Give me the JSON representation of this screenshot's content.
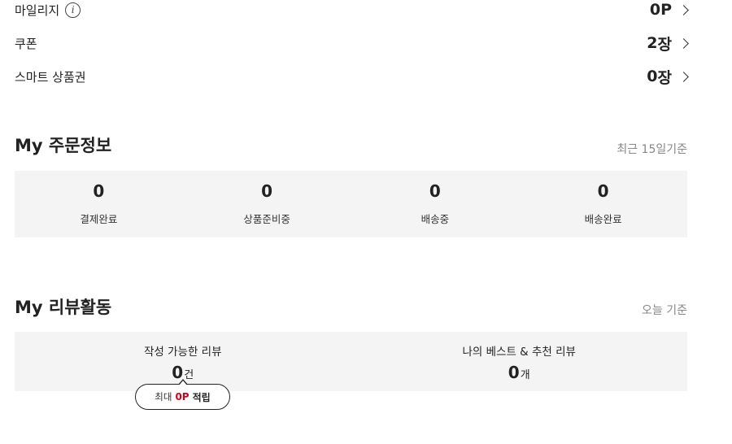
{
  "benefits": [
    {
      "label": "마일리지",
      "value": "0",
      "unit": "P",
      "has_info": true
    },
    {
      "label": "쿠폰",
      "value": "2",
      "unit": "장",
      "has_info": false
    },
    {
      "label": "스마트 상품권",
      "value": "0",
      "unit": "장",
      "has_info": false
    }
  ],
  "orders": {
    "title": "My 주문정보",
    "note": "최근 15일기준",
    "items": [
      {
        "count": "0",
        "label": "결제완료"
      },
      {
        "count": "0",
        "label": "상품준비중"
      },
      {
        "count": "0",
        "label": "배송중"
      },
      {
        "count": "0",
        "label": "배송완료"
      }
    ]
  },
  "reviews": {
    "title": "My 리뷰활동",
    "note": "오늘 기준",
    "items": [
      {
        "label": "작성 가능한 리뷰",
        "count": "0",
        "unit": "건"
      },
      {
        "label": "나의 베스트 & 추천 리뷰",
        "count": "0",
        "unit": "개"
      }
    ],
    "tooltip": {
      "prefix": "최대",
      "amount": "0P",
      "suffix": "적립"
    }
  },
  "icons": {
    "info": "info-circle-icon",
    "chevron": "chevron-right-icon"
  },
  "colors": {
    "accent_red": "#d0021b",
    "box_bg": "#f4f4f4",
    "note_gray": "#888888"
  }
}
